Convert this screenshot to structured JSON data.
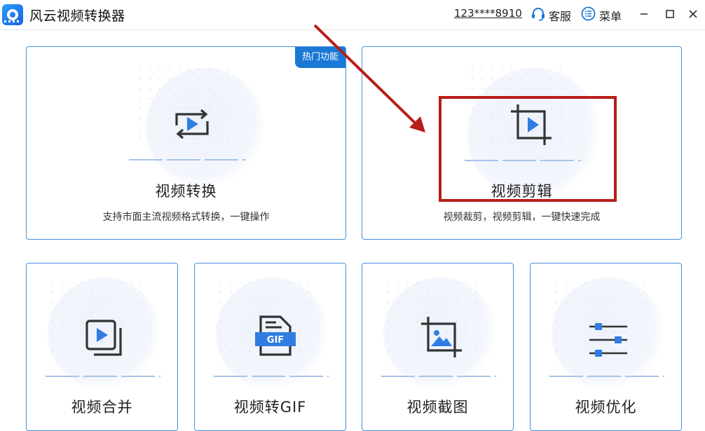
{
  "app": {
    "title": "风云视频转换器",
    "account": "123****8910"
  },
  "header": {
    "service_label": "客服",
    "menu_label": "菜单"
  },
  "features": [
    {
      "title": "视频转换",
      "desc": "支持市面主流视频格式转换，一键操作",
      "badge": "热门功能",
      "icon": "convert-video-icon"
    },
    {
      "title": "视频剪辑",
      "desc": "视频裁剪，视频剪辑，一键快速完成",
      "icon": "crop-video-icon"
    },
    {
      "title": "视频合并",
      "icon": "merge-video-icon"
    },
    {
      "title": "视频转GIF",
      "icon": "gif-file-icon",
      "icon_text": "GIF"
    },
    {
      "title": "视频截图",
      "icon": "crop-image-icon"
    },
    {
      "title": "视频优化",
      "icon": "sliders-icon"
    }
  ],
  "colors": {
    "accent": "#1a78d6",
    "card_border": "#4b8fd9",
    "icon_play": "#2f7de1",
    "annotation": "#b81d19"
  }
}
